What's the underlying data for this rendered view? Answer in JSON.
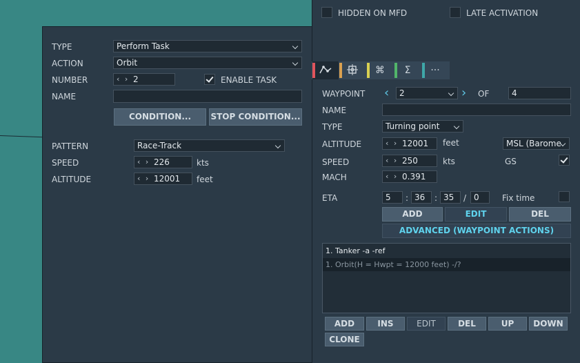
{
  "top_options": {
    "hidden_on_mfd": "HIDDEN ON MFD",
    "late_activation": "LATE ACTIVATION"
  },
  "task": {
    "type_label": "TYPE",
    "type_value": "Perform Task",
    "action_label": "ACTION",
    "action_value": "Orbit",
    "number_label": "NUMBER",
    "number_value": "2",
    "enable_task_label": "ENABLE TASK",
    "enable_task_checked": true,
    "name_label": "NAME",
    "name_value": "",
    "condition_button": "CONDITION...",
    "stop_condition_button": "STOP CONDITION...",
    "pattern_label": "PATTERN",
    "pattern_value": "Race-Track",
    "speed_label": "SPEED",
    "speed_value": "226",
    "speed_unit": "kts",
    "altitude_label": "ALTITUDE",
    "altitude_value": "12001",
    "altitude_unit": "feet"
  },
  "tabs": [
    {
      "icon": "route-icon",
      "glyph": "⌒",
      "color": "#e0545c"
    },
    {
      "icon": "target-icon",
      "glyph": "⊠",
      "color": "#d9a050"
    },
    {
      "icon": "command-icon",
      "glyph": "⌘",
      "color": "#d8d052"
    },
    {
      "icon": "sigma-icon",
      "glyph": "Σ",
      "color": "#52b56a"
    },
    {
      "icon": "more-icon",
      "glyph": "···",
      "color": "#3fa7a8"
    }
  ],
  "waypoint": {
    "waypoint_label": "WAYPOINT",
    "waypoint_value": "2",
    "of_label": "OF",
    "of_value": "4",
    "name_label": "NAME",
    "name_value": "",
    "type_label": "TYPE",
    "type_value": "Turning point",
    "altitude_label": "ALTITUDE",
    "altitude_value": "12001",
    "altitude_unit": "feet",
    "altitude_ref": "MSL (Barome",
    "speed_label": "SPEED",
    "speed_value": "250",
    "speed_unit": "kts",
    "gs_label": "GS",
    "gs_checked": true,
    "mach_label": "MACH",
    "mach_value": "0.391",
    "eta_label": "ETA",
    "eta_h": "5",
    "eta_m": "36",
    "eta_s": "35",
    "eta_sep1": ":",
    "eta_sep2": ":",
    "eta_slash": "/",
    "eta_d": "0",
    "fix_time_label": "Fix time",
    "add_button": "ADD",
    "edit_button": "EDIT",
    "del_button": "DEL",
    "advanced_button": "ADVANCED (WAYPOINT ACTIONS)"
  },
  "actions_list": {
    "items": [
      "1. Tanker -a -ref",
      "1. Orbit(H = Hwpt = 12000 feet)  -/?"
    ]
  },
  "bottom_buttons": {
    "add": "ADD",
    "ins": "INS",
    "edit": "EDIT",
    "del": "DEL",
    "up": "UP",
    "down": "DOWN",
    "clone": "CLONE"
  }
}
